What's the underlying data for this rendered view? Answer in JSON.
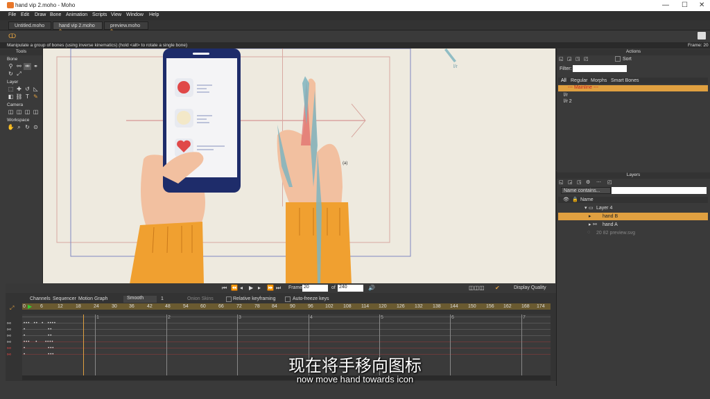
{
  "window": {
    "title": "hand vip 2.moho - Moho",
    "minimize": "—",
    "maximize": "☐",
    "close": "✕"
  },
  "menu": [
    "File",
    "Edit",
    "Draw",
    "Bone",
    "Animation",
    "Scripts",
    "View",
    "Window",
    "Help"
  ],
  "tabs": [
    {
      "label": "Untitled.moho"
    },
    {
      "label": "hand vip 2.moho"
    },
    {
      "label": "preview.moho"
    }
  ],
  "status": {
    "message": "Manipulate a group of bones (using inverse kinematics) (hold <alt> to rotate a single bone)",
    "frame": "Frame: 20"
  },
  "tools": {
    "title": "Tools",
    "bone": "Bone",
    "layer": "Layer",
    "camera": "Camera",
    "workspace": "Workspace"
  },
  "canvas": {
    "bone_label_1": "l/r",
    "annotation": "(a)"
  },
  "actions": {
    "title": "Actions",
    "sort": "Sort",
    "filter_label": "Filter:",
    "filter_value": "",
    "tabs": [
      "All",
      "Regular",
      "Morphs",
      "Smart Bones"
    ],
    "items": [
      "--- Mainline ---",
      "l/r",
      "l/r 2"
    ]
  },
  "layers": {
    "title": "Layers",
    "search_mode": "Name contains...",
    "search_value": "",
    "name_header": "Name",
    "items": [
      {
        "name": "Layer 4"
      },
      {
        "name": "hand B"
      },
      {
        "name": "hand A"
      },
      {
        "name": "20 82 preview.svg"
      }
    ]
  },
  "playbar": {
    "frame_label": "Frame",
    "frame_value": "20",
    "of_label": "of",
    "total_frames": "240",
    "display_quality": "Display Quality"
  },
  "timeline": {
    "tabs": [
      "Channels",
      "Sequencer",
      "Motion Graph"
    ],
    "interp": "Smooth",
    "interp_num": "1",
    "onion": "Onion Skins",
    "relative": "Relative keyframing",
    "autofreeze": "Auto-freeze keys",
    "ruler": [
      "0",
      "6",
      "12",
      "18",
      "24",
      "30",
      "36",
      "42",
      "48",
      "54",
      "60",
      "66",
      "72",
      "78",
      "84",
      "90",
      "96",
      "102",
      "108",
      "114",
      "120",
      "126",
      "132",
      "138",
      "144",
      "150",
      "156",
      "162",
      "168",
      "174"
    ],
    "markers": [
      "1",
      "2",
      "3",
      "4",
      "5",
      "6",
      "7"
    ]
  },
  "subtitles": {
    "cn": "现在将手移向图标",
    "en": "now move hand towards icon"
  },
  "colors": {
    "accent": "#e0a040",
    "canvas": "#eeeadf",
    "phone": "#1e2c6a",
    "sleeve": "#f0a030",
    "skin": "#f2c0a0",
    "bone": "#7fb5c0"
  }
}
